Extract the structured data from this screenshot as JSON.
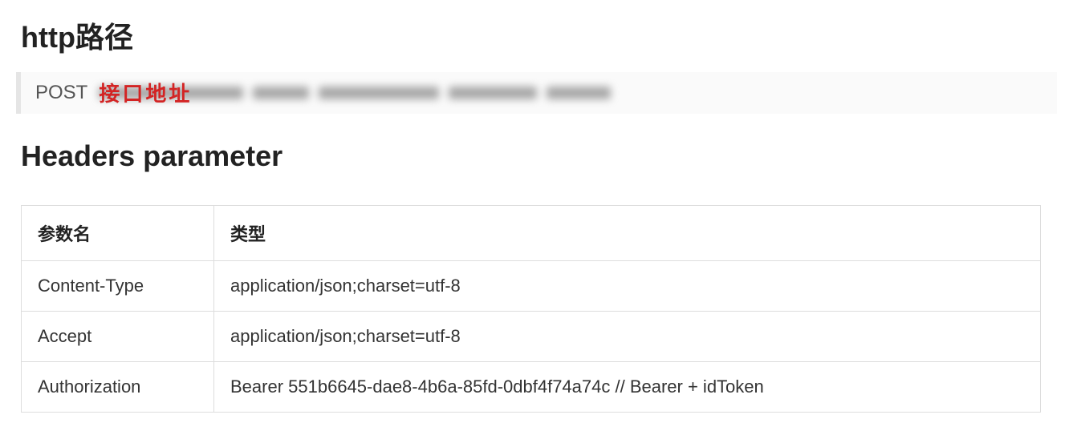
{
  "sections": {
    "httpPath": {
      "title": "http路径"
    },
    "headersParam": {
      "title": "Headers parameter"
    }
  },
  "request": {
    "method": "POST",
    "overlayLabel": "接口地址"
  },
  "table": {
    "columns": {
      "param": "参数名",
      "type": "类型"
    },
    "rows": [
      {
        "param": "Content-Type",
        "type": "application/json;charset=utf-8"
      },
      {
        "param": "Accept",
        "type": "application/json;charset=utf-8"
      },
      {
        "param": "Authorization",
        "type": "Bearer 551b6645-dae8-4b6a-85fd-0dbf4f74a74c    // Bearer + idToken"
      }
    ]
  }
}
